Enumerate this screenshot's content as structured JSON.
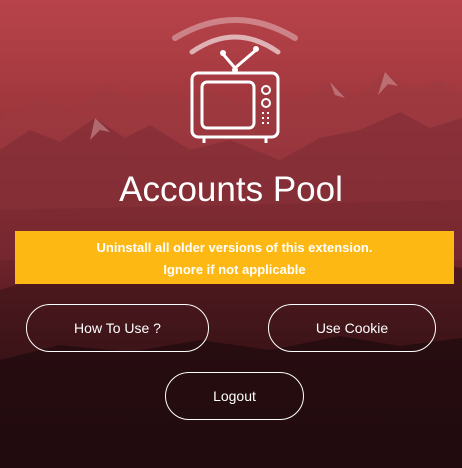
{
  "app": {
    "title": "Accounts Pool",
    "logo_icon": "tv-antenna-icon"
  },
  "notice": {
    "line1": "Uninstall all older versions of this extension.",
    "line2": "Ignore if not applicable",
    "background": "#fdb813"
  },
  "buttons": {
    "how_to_use": "How To Use ?",
    "use_cookie": "Use Cookie",
    "logout": "Logout"
  },
  "colors": {
    "background_top": "#b8434a",
    "background_bottom": "#120709",
    "text": "#ffffff"
  }
}
